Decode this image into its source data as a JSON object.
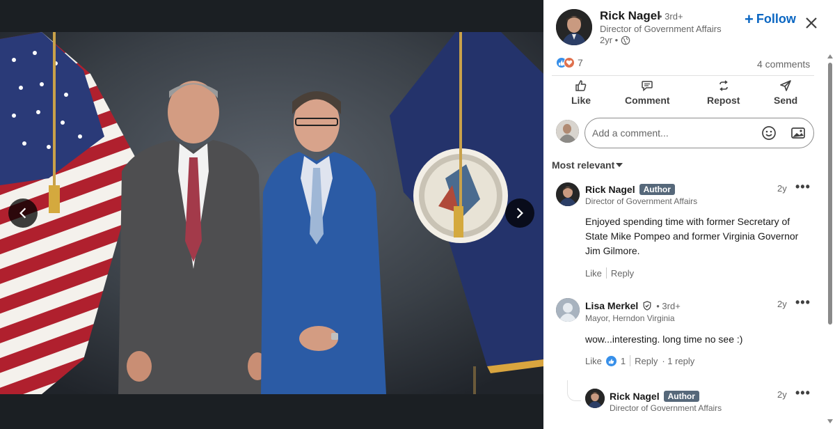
{
  "viewer": {
    "prev_label": "Previous image",
    "next_label": "Next image"
  },
  "post": {
    "author_name": "Rick Nagel",
    "author_degree": "• 3rd+",
    "author_title": "Director of Government Affairs",
    "posted_time": "2yr •",
    "follow_label": "Follow",
    "reaction_count": "7",
    "comments_count": "4 comments"
  },
  "actions": {
    "like": "Like",
    "comment": "Comment",
    "repost": "Repost",
    "send": "Send"
  },
  "comment_box": {
    "placeholder": "Add a comment..."
  },
  "sort": {
    "label": "Most relevant"
  },
  "comments": [
    {
      "name": "Rick Nagel",
      "badge": "Author",
      "subtitle": "Director of Government Affairs",
      "time": "2y",
      "text": "Enjoyed spending time with former Secretary of State Mike Pompeo and former Virginia Governor Jim Gilmore.",
      "like_label": "Like",
      "reply_label": "Reply"
    },
    {
      "name": "Lisa Merkel",
      "degree": "• 3rd+",
      "subtitle": "Mayor, Herndon Virginia",
      "time": "2y",
      "text": "wow...interesting. long time no see :)",
      "like_label": "Like",
      "like_count": "1",
      "reply_label": "Reply",
      "replies_label": "· 1 reply"
    },
    {
      "name": "Rick Nagel",
      "badge": "Author",
      "subtitle": "Director of Government Affairs",
      "time": "2y"
    }
  ],
  "colors": {
    "brand_blue": "#0a66c2",
    "author_badge": "#56687a",
    "like_reaction": "#378fe9",
    "love_reaction": "#df704d"
  }
}
